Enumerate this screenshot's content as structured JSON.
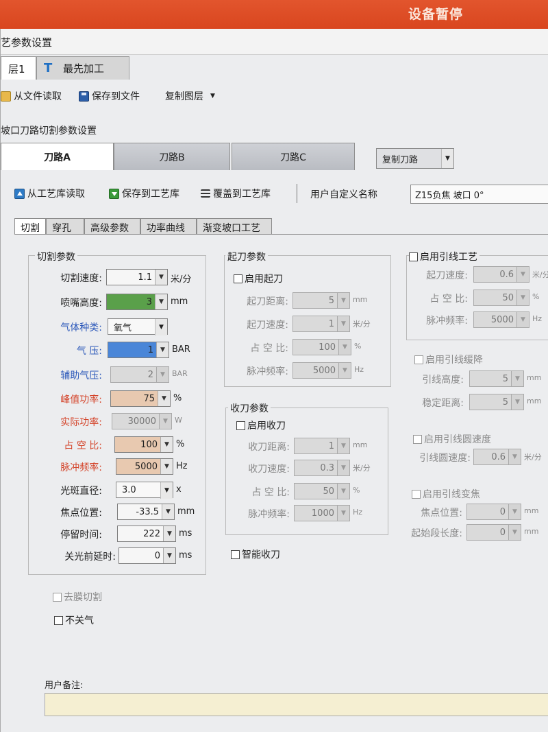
{
  "status_bar": {
    "text": "设备暂停"
  },
  "window": {
    "title": "艺参数设置"
  },
  "layer_tabs": [
    {
      "label": "层1"
    },
    {
      "label": "最先加工"
    }
  ],
  "toolbar1": {
    "read_file": "从文件读取",
    "save_file": "保存到文件",
    "copy_layer": "复制图层"
  },
  "section_title": "坡口刀路切割参数设置",
  "path_tabs": [
    {
      "label": "刀路A"
    },
    {
      "label": "刀路B"
    },
    {
      "label": "刀路C"
    }
  ],
  "copy_path": "复制刀路",
  "toolbar2": {
    "read_lib": "从工艺库读取",
    "save_lib": "保存到工艺库",
    "overwrite_lib": "覆盖到工艺库",
    "custom_name_label": "用户自定义名称",
    "custom_name_value": "Z15负焦 坡口 0°"
  },
  "sub_tabs": [
    {
      "label": "切割"
    },
    {
      "label": "穿孔"
    },
    {
      "label": "高级参数"
    },
    {
      "label": "功率曲线"
    },
    {
      "label": "渐变坡口工艺"
    }
  ],
  "cut_params": {
    "title": "切割参数",
    "rows": [
      {
        "label": "切割速度:",
        "value": "1.1",
        "unit": "米/分"
      },
      {
        "label": "喷嘴高度:",
        "value": "3",
        "unit": "mm"
      },
      {
        "label": "气体种类:",
        "value": "氧气",
        "unit": ""
      },
      {
        "label": "气      压:",
        "value": "1",
        "unit": "BAR"
      },
      {
        "label": "辅助气压:",
        "value": "2",
        "unit": "BAR"
      },
      {
        "label": "峰值功率:",
        "value": "75",
        "unit": "%"
      },
      {
        "label": "实际功率:",
        "value": "30000",
        "unit": "W"
      },
      {
        "label": "占 空 比:",
        "value": "100",
        "unit": "%"
      },
      {
        "label": "脉冲频率:",
        "value": "5000",
        "unit": "Hz"
      },
      {
        "label": "光斑直径:",
        "value": "3.0",
        "unit": "x"
      },
      {
        "label": "焦点位置:",
        "value": "-33.5",
        "unit": "mm"
      },
      {
        "label": "停留时间:",
        "value": "222",
        "unit": "ms"
      },
      {
        "label": "关光前延时:",
        "value": "0",
        "unit": "ms"
      }
    ]
  },
  "start_params": {
    "title": "起刀参数",
    "enable": "启用起刀",
    "rows": [
      {
        "label": "起刀距离:",
        "value": "5",
        "unit": "mm"
      },
      {
        "label": "起刀速度:",
        "value": "1",
        "unit": "米/分"
      },
      {
        "label": "占 空 比:",
        "value": "100",
        "unit": "%"
      },
      {
        "label": "脉冲频率:",
        "value": "5000",
        "unit": "Hz"
      }
    ]
  },
  "end_params": {
    "title": "收刀参数",
    "enable": "启用收刀",
    "rows": [
      {
        "label": "收刀距离:",
        "value": "1",
        "unit": "mm"
      },
      {
        "label": "收刀速度:",
        "value": "0.3",
        "unit": "米/分"
      },
      {
        "label": "占 空 比:",
        "value": "50",
        "unit": "%"
      },
      {
        "label": "脉冲频率:",
        "value": "1000",
        "unit": "Hz"
      }
    ]
  },
  "smart_end": "智能收刀",
  "lead_process": {
    "enable": "启用引线工艺",
    "rows": [
      {
        "label": "起刀速度:",
        "value": "0.6",
        "unit": "米/分"
      },
      {
        "label": "占 空 比:",
        "value": "50",
        "unit": "%"
      },
      {
        "label": "脉冲频率:",
        "value": "5000",
        "unit": "Hz"
      }
    ]
  },
  "lead_slow": {
    "enable": "启用引线缓降",
    "rows": [
      {
        "label": "引线高度:",
        "value": "5",
        "unit": "mm"
      },
      {
        "label": "稳定距离:",
        "value": "5",
        "unit": "mm"
      }
    ]
  },
  "lead_arc": {
    "enable": "启用引线圆速度",
    "rows": [
      {
        "label": "引线圆速度:",
        "value": "0.6",
        "unit": "米/分"
      }
    ]
  },
  "lead_focus": {
    "enable": "启用引线变焦",
    "rows": [
      {
        "label": "焦点位置:",
        "value": "0",
        "unit": "mm"
      },
      {
        "label": "起始段长度:",
        "value": "0",
        "unit": "mm"
      }
    ]
  },
  "film_cut": "去膜切割",
  "no_gas_off": "不关气",
  "user_note": {
    "label": "用户备注:",
    "value": ""
  },
  "colors": {
    "nozzle_field": "#5aa04a",
    "pressure_field": "#4a86d8",
    "power_field": "#e8c9b0",
    "titlebar": "#d9461f"
  }
}
